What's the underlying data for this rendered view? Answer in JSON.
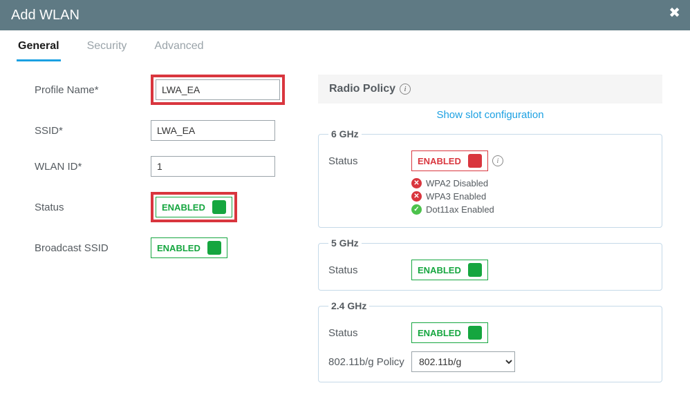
{
  "window": {
    "title": "Add WLAN"
  },
  "tabs": {
    "general": "General",
    "security": "Security",
    "advanced": "Advanced",
    "active": "general"
  },
  "form": {
    "profile_name": {
      "label": "Profile Name*",
      "value": "LWA_EA"
    },
    "ssid": {
      "label": "SSID*",
      "value": "LWA_EA"
    },
    "wlan_id": {
      "label": "WLAN ID*",
      "value": "1"
    },
    "status": {
      "label": "Status",
      "text": "ENABLED",
      "state": "green"
    },
    "broadcast": {
      "label": "Broadcast SSID",
      "text": "ENABLED",
      "state": "green"
    }
  },
  "radio_policy": {
    "heading": "Radio Policy",
    "slot_link": "Show slot configuration",
    "ghz6": {
      "legend": "6 GHz",
      "status_label": "Status",
      "status_text": "ENABLED",
      "status_state": "red",
      "notes": [
        {
          "icon": "err",
          "text": "WPA2 Disabled"
        },
        {
          "icon": "err",
          "text": "WPA3 Enabled"
        },
        {
          "icon": "ok",
          "text": "Dot11ax Enabled"
        }
      ]
    },
    "ghz5": {
      "legend": "5 GHz",
      "status_label": "Status",
      "status_text": "ENABLED",
      "status_state": "green"
    },
    "ghz24": {
      "legend": "2.4 GHz",
      "status_label": "Status",
      "status_text": "ENABLED",
      "status_state": "green",
      "policy_label": "802.11b/g Policy",
      "policy_value": "802.11b/g"
    }
  }
}
